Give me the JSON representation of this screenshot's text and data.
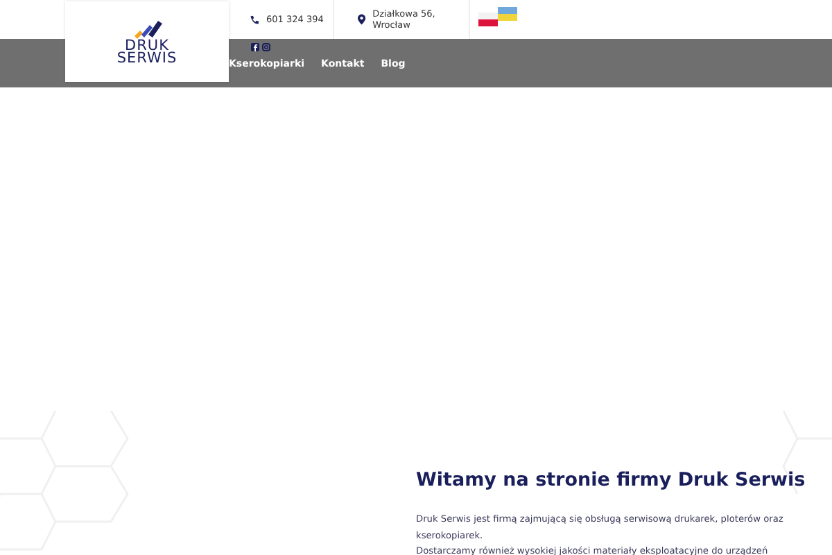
{
  "logo": {
    "line_1": "DRUK",
    "line_2": "SERWIS"
  },
  "contact": {
    "phone": "601 324 394",
    "address": "Działkowa 56, Wrocław"
  },
  "nav": {
    "items": [
      {
        "label": "Kserokopiarki"
      },
      {
        "label": "Kontakt"
      },
      {
        "label": "Blog"
      }
    ]
  },
  "welcome": {
    "heading": "Witamy na stronie firmy Druk Serwis",
    "paragraph": [
      "Druk Serwis jest firmą zajmującą się obsługą serwisową drukarek, ploterów oraz kserokopiarek.",
      "Dostarczamy również wysokiej jakości materiały eksploatacyjne do urządzeń"
    ]
  }
}
